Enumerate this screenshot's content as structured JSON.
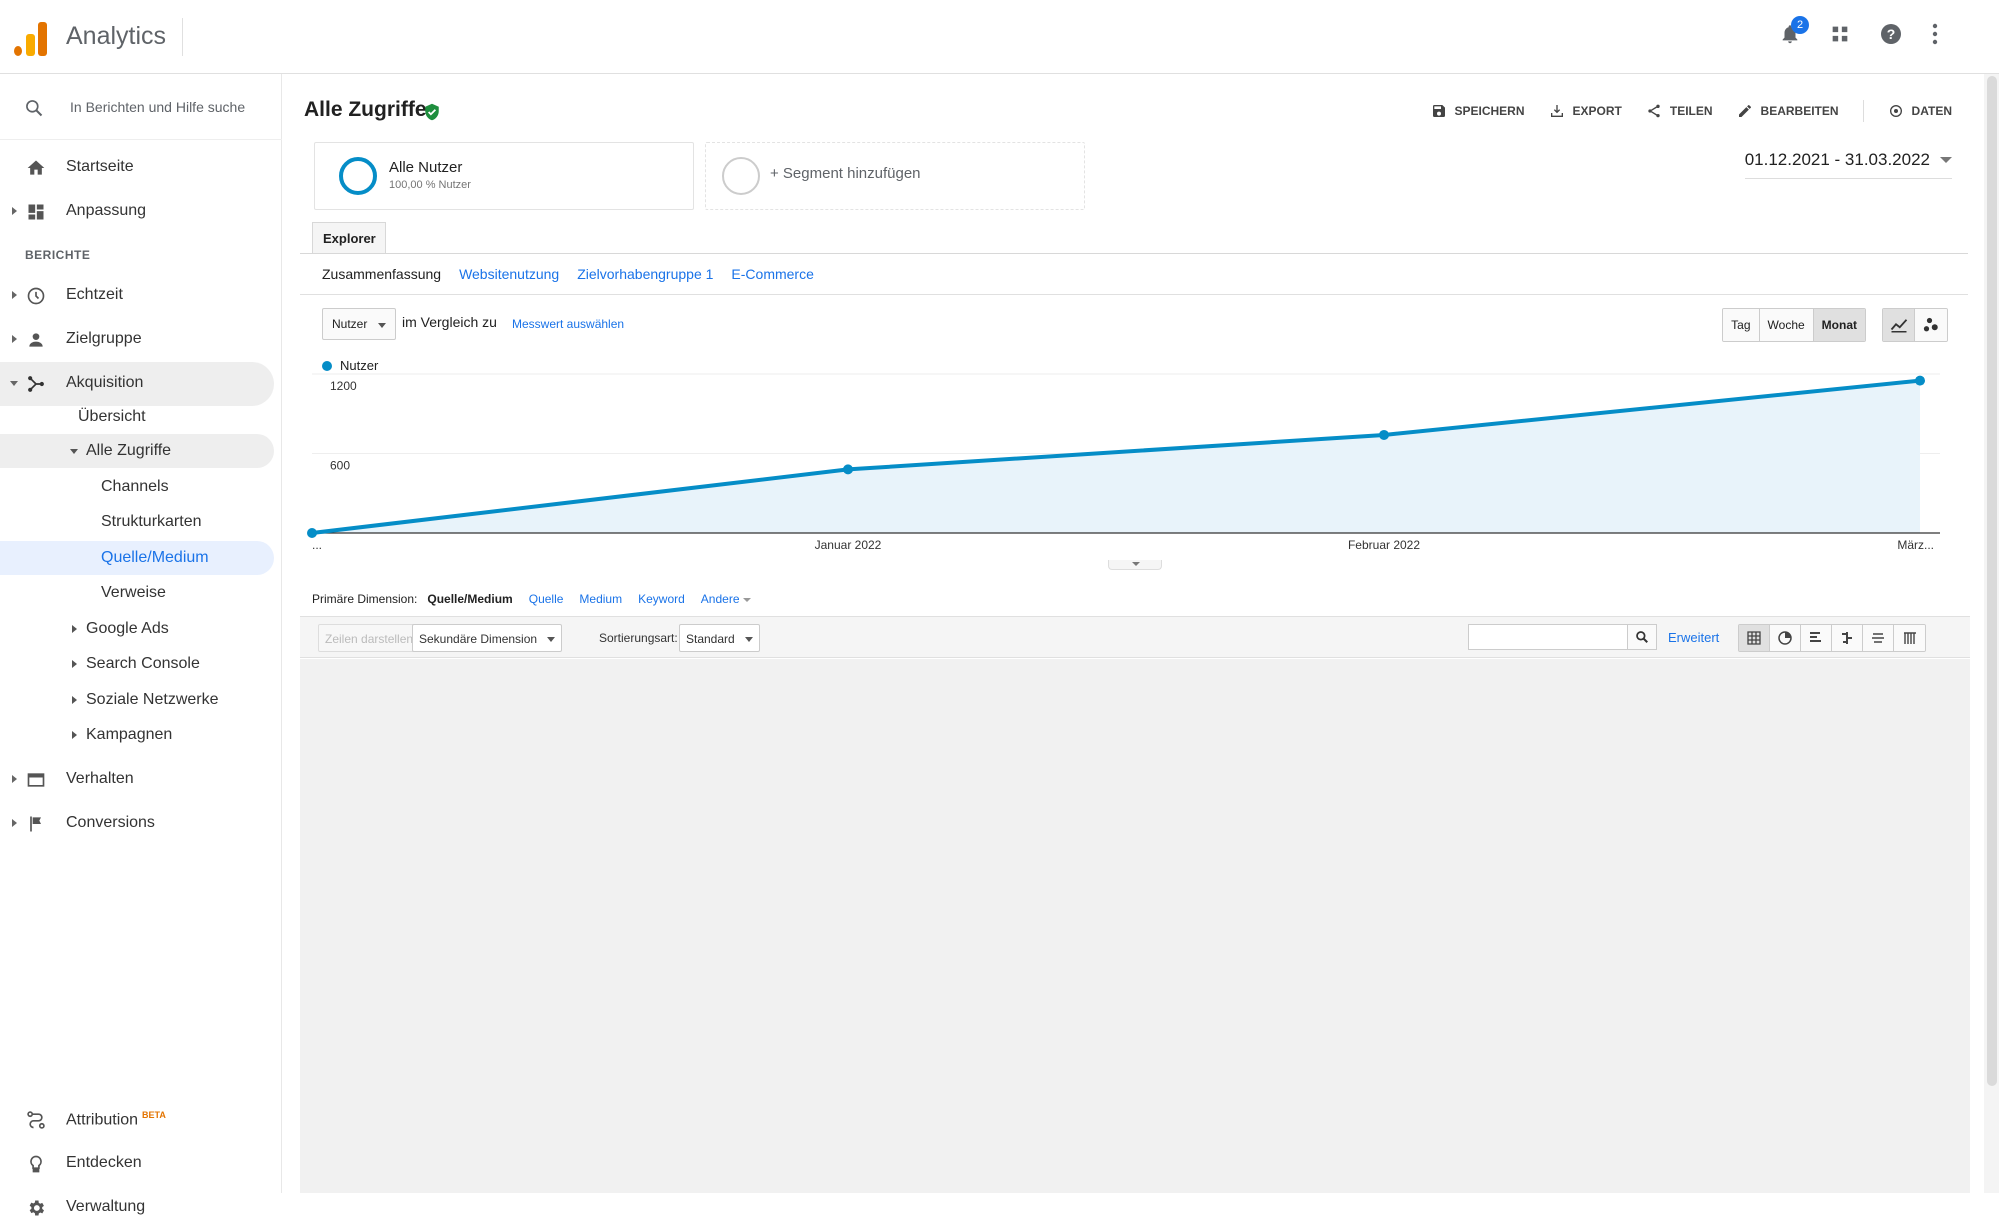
{
  "app": {
    "title": "Analytics",
    "notification_count": "2",
    "accent": "#1a73e8"
  },
  "search": {
    "placeholder": "In Berichten und Hilfe suche"
  },
  "sidebar": {
    "home": "Startseite",
    "custom": "Anpassung",
    "section": "BERICHTE",
    "realtime": "Echtzeit",
    "audience": "Zielgruppe",
    "acquisition": "Akquisition",
    "overview": "Übersicht",
    "all_traffic": "Alle Zugriffe",
    "channels": "Channels",
    "treemaps": "Strukturkarten",
    "source_medium": "Quelle/Medium",
    "referrals": "Verweise",
    "google_ads": "Google Ads",
    "search_console": "Search Console",
    "social": "Soziale Netzwerke",
    "campaigns": "Kampagnen",
    "behavior": "Verhalten",
    "conversions": "Conversions",
    "attribution": "Attribution",
    "attribution_badge": "BETA",
    "discover": "Entdecken",
    "admin": "Verwaltung"
  },
  "report": {
    "title": "Alle Zugriffe",
    "actions": [
      "SPEICHERN",
      "EXPORT",
      "TEILEN",
      "BEARBEITEN",
      "DATEN"
    ],
    "segment1_name": "Alle Nutzer",
    "segment1_sub": "100,00 % Nutzer",
    "segment_add": "+ Segment hinzufügen",
    "date_range": "01.12.2021 - 31.03.2022",
    "tab": "Explorer",
    "subtabs": [
      "Zusammenfassung",
      "Websitenutzung",
      "Zielvorhabengruppe 1",
      "E-Commerce"
    ],
    "metric": "Nutzer",
    "compare_label": "im Vergleich zu",
    "compare_link": "Messwert auswählen",
    "periods": [
      "Tag",
      "Woche",
      "Monat"
    ],
    "primary_dim_label": "Primäre Dimension:",
    "primary_dims": [
      "Quelle/Medium",
      "Quelle",
      "Medium",
      "Keyword",
      "Andere"
    ],
    "toolbar": {
      "plot_rows": "Zeilen darstellen",
      "secondary": "Sekundäre Dimension",
      "sort_label": "Sortierungsart:",
      "sort_value": "Standard",
      "advanced": "Erweitert"
    }
  },
  "chart_data": {
    "type": "area",
    "series": [
      {
        "name": "Nutzer",
        "values": [
          0,
          480,
          740,
          1150
        ],
        "color": "#058dc7"
      }
    ],
    "x": [
      "...",
      "Januar 2022",
      "Februar 2022",
      "März..."
    ],
    "y_ticks": [
      600,
      1200
    ],
    "ylim": [
      0,
      1200
    ],
    "grid": true,
    "legend": "top-left"
  }
}
